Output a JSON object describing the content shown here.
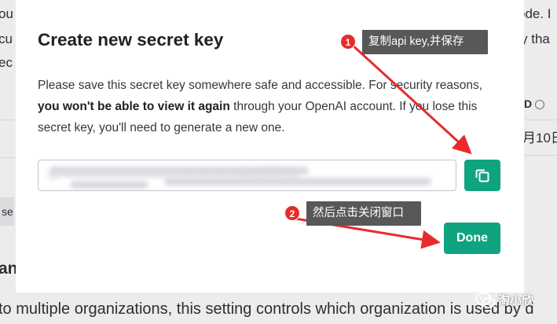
{
  "background": {
    "left_lines": [
      "ou",
      "cu",
      "ec"
    ],
    "right_lines": [
      "ode. I",
      "y tha",
      "D",
      "月10日"
    ],
    "chip_label": "se",
    "heading_fragment": "an",
    "bottom_text": "to multiple organizations, this setting controls which organization is used by d"
  },
  "modal": {
    "title": "Create new secret key",
    "desc_part1": "Please save this secret key somewhere safe and accessible. For security reasons, ",
    "desc_bold": "you won't be able to view it again",
    "desc_part2": " through your OpenAI account. If you lose this secret key, you'll need to generate a new one.",
    "key_value": "sk-••••••••••••••••••••••••••••••••••••••••••3kNk3fSG8",
    "done_label": "Done"
  },
  "annotations": [
    {
      "number": "1",
      "text": "复制api key,并保存"
    },
    {
      "number": "2",
      "text": "然后点击关闭窗口"
    }
  ],
  "watermark": {
    "text": "淘小欣"
  },
  "colors": {
    "accent": "#10a37f",
    "annotation_red": "#e82b2b",
    "annotation_label_bg": "#585858"
  },
  "icons": {
    "copy": "copy-icon",
    "info": "info-icon",
    "watermark": "wechat-icon"
  }
}
